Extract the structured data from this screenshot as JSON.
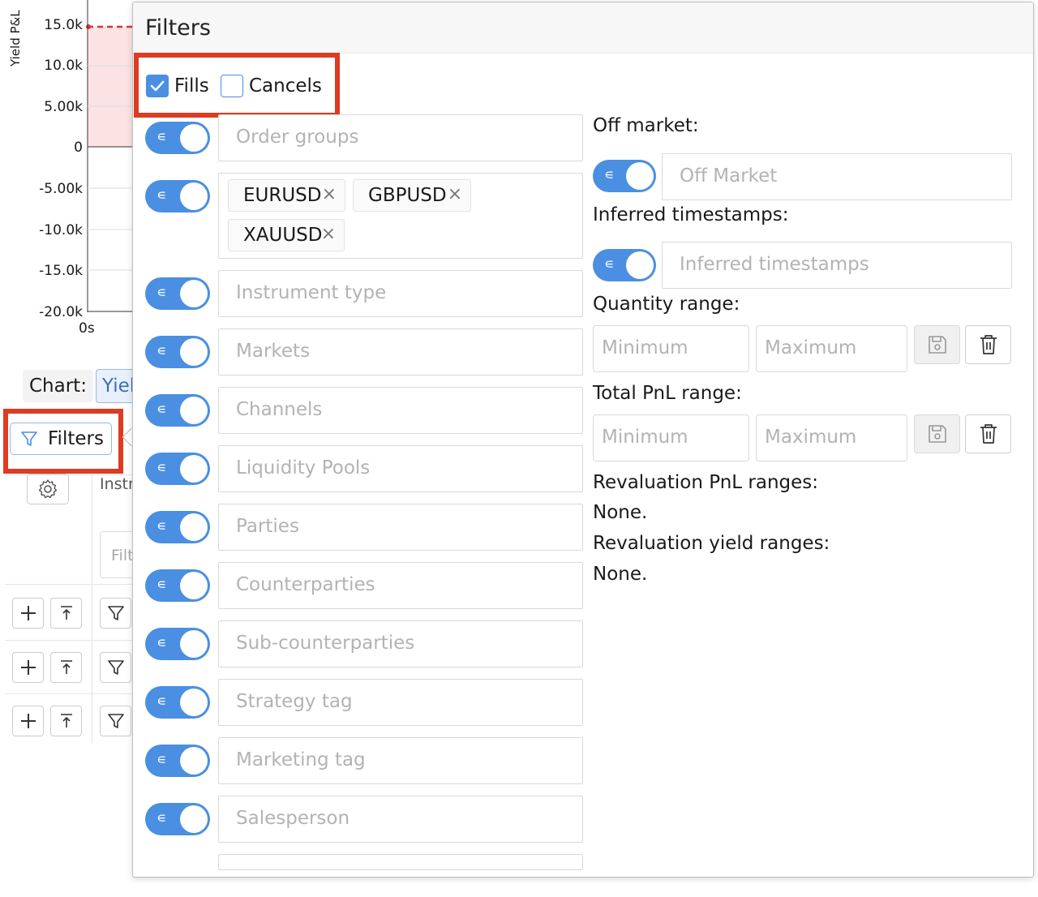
{
  "chart": {
    "y_axis_label": "Yield P&L",
    "y_ticks": [
      "15.0k",
      "10.0k",
      "5.00k",
      "0",
      "-5.00k",
      "-10.0k",
      "-15.0k",
      "-20.0k"
    ],
    "x_ticks": [
      "0s"
    ],
    "series_color": "#e03030",
    "fill_color": "#fbe3e3"
  },
  "chart_control": {
    "label": "Chart:",
    "selected_value": "Yiel"
  },
  "filters_button": {
    "label": "Filters"
  },
  "table": {
    "column_header": "Instr",
    "filter_placeholder": "Filt"
  },
  "popover": {
    "title": "Filters",
    "checkboxes": [
      {
        "label": "Fills",
        "checked": true
      },
      {
        "label": "Cancels",
        "checked": false
      }
    ],
    "toggle_symbol": "∊",
    "left_filters": [
      {
        "placeholder": "Order groups"
      },
      {
        "chips": [
          "EURUSD",
          "GBPUSD",
          "XAUUSD"
        ]
      },
      {
        "placeholder": "Instrument type"
      },
      {
        "placeholder": "Markets"
      },
      {
        "placeholder": "Channels"
      },
      {
        "placeholder": "Liquidity Pools"
      },
      {
        "placeholder": "Parties"
      },
      {
        "placeholder": "Counterparties"
      },
      {
        "placeholder": "Sub-counterparties"
      },
      {
        "placeholder": "Strategy tag"
      },
      {
        "placeholder": "Marketing tag"
      },
      {
        "placeholder": "Salesperson"
      }
    ],
    "right": {
      "off_market": {
        "label": "Off market:",
        "placeholder": "Off Market"
      },
      "inferred_timestamps": {
        "label": "Inferred timestamps:",
        "placeholder": "Inferred timestamps"
      },
      "quantity_range": {
        "label": "Quantity range:",
        "min_placeholder": "Minimum",
        "max_placeholder": "Maximum"
      },
      "total_pnl_range": {
        "label": "Total PnL range:",
        "min_placeholder": "Minimum",
        "max_placeholder": "Maximum"
      },
      "revaluation_pnl_ranges": {
        "label": "Revaluation PnL ranges:",
        "value": "None."
      },
      "revaluation_yield_ranges": {
        "label": "Revaluation yield ranges:",
        "value": "None."
      }
    }
  },
  "colors": {
    "accent": "#4a8fe2",
    "highlight_outline": "#dd3b22"
  }
}
